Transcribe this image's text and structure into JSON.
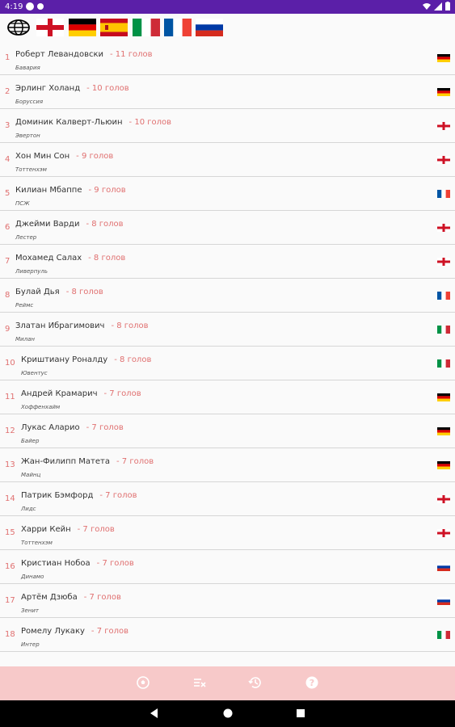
{
  "status_bar": {
    "time": "4:19"
  },
  "flag_filters": [
    {
      "name": "world",
      "icon": "globe-icon"
    },
    {
      "name": "england",
      "icon": "flag-england-icon"
    },
    {
      "name": "germany",
      "icon": "flag-germany-icon"
    },
    {
      "name": "spain",
      "icon": "flag-spain-icon"
    },
    {
      "name": "italy",
      "icon": "flag-italy-icon"
    },
    {
      "name": "france",
      "icon": "flag-france-icon"
    },
    {
      "name": "russia",
      "icon": "flag-russia-icon"
    }
  ],
  "players": [
    {
      "rank": "1",
      "name": "Роберт Левандовски",
      "goals": "- 11 голов",
      "club": "Бавария",
      "flag": "de"
    },
    {
      "rank": "2",
      "name": "Эрлинг Холанд",
      "goals": "- 10 голов",
      "club": "Боруссия",
      "flag": "de"
    },
    {
      "rank": "3",
      "name": "Доминик Калверт-Льюин",
      "goals": "- 10 голов",
      "club": "Эвертон",
      "flag": "en"
    },
    {
      "rank": "4",
      "name": "Хон Мин Сон",
      "goals": "- 9 голов",
      "club": "Тоттенхэм",
      "flag": "en"
    },
    {
      "rank": "5",
      "name": "Килиан Мбаппе",
      "goals": "- 9 голов",
      "club": "ПСЖ",
      "flag": "fr"
    },
    {
      "rank": "6",
      "name": "Джейми Варди",
      "goals": "- 8 голов",
      "club": "Лестер",
      "flag": "en"
    },
    {
      "rank": "7",
      "name": "Мохамед Салах",
      "goals": "- 8 голов",
      "club": "Ливерпуль",
      "flag": "en"
    },
    {
      "rank": "8",
      "name": "Булай Дья",
      "goals": "- 8 голов",
      "club": "Реймс",
      "flag": "fr"
    },
    {
      "rank": "9",
      "name": "Златан Ибрагимович",
      "goals": "- 8 голов",
      "club": "Милан",
      "flag": "it"
    },
    {
      "rank": "10",
      "name": "Криштиану Роналду",
      "goals": "- 8 голов",
      "club": "Ювентус",
      "flag": "it"
    },
    {
      "rank": "11",
      "name": "Андрей Крамарич",
      "goals": "- 7 голов",
      "club": "Хоффенхайм",
      "flag": "de"
    },
    {
      "rank": "12",
      "name": "Лукас Аларио",
      "goals": "- 7 голов",
      "club": "Байер",
      "flag": "de"
    },
    {
      "rank": "13",
      "name": "Жан-Филипп Матета",
      "goals": "- 7 голов",
      "club": "Майнц",
      "flag": "de"
    },
    {
      "rank": "14",
      "name": "Патрик Бэмфорд",
      "goals": "- 7 голов",
      "club": "Лидс",
      "flag": "en"
    },
    {
      "rank": "15",
      "name": "Харри Кейн",
      "goals": "- 7 голов",
      "club": "Тоттенхэм",
      "flag": "en"
    },
    {
      "rank": "16",
      "name": "Кристиан Нобоа",
      "goals": "- 7 голов",
      "club": "Динамо",
      "flag": "ru"
    },
    {
      "rank": "17",
      "name": "Артём Дзюба",
      "goals": "- 7 голов",
      "club": "Зенит",
      "flag": "ru"
    },
    {
      "rank": "18",
      "name": "Ромелу Лукаку",
      "goals": "- 7 голов",
      "club": "Интер",
      "flag": "it"
    }
  ],
  "bottom_nav": [
    {
      "name": "ball",
      "icon": "soccer-ball-icon"
    },
    {
      "name": "filter",
      "icon": "shuffle-filter-icon"
    },
    {
      "name": "history",
      "icon": "history-icon"
    },
    {
      "name": "help",
      "icon": "help-icon"
    }
  ],
  "colors": {
    "status_bar": "#5b1fa8",
    "accent": "#e07070",
    "bottom_nav": "#f7c9c9"
  }
}
